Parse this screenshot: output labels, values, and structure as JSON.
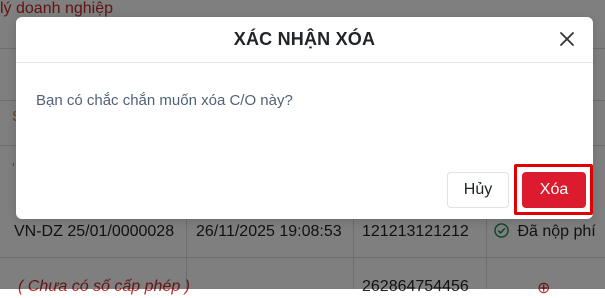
{
  "background": {
    "page_title": "lý doanh nghiệp",
    "row1": {
      "code": "VN-DZ 25/01/0000028",
      "datetime": "26/11/2025 19:08:53",
      "number": "121213121212",
      "status": "Đã nộp phí"
    },
    "row2": {
      "code": "( Chưa có số cấp phép )",
      "number": "262864754456"
    }
  },
  "dialog": {
    "title": "XÁC NHẬN XÓA",
    "message": "Bạn có chắc chắn muốn xóa C/O này?",
    "cancel_label": "Hủy",
    "delete_label": "Xóa"
  },
  "colors": {
    "delete_button": "#dc1c2e",
    "highlight_outline": "#e00000",
    "overlay": "rgba(0,0,0,0.5)"
  },
  "icons": {
    "close": "close-icon",
    "status_ok": "check-circle-icon"
  }
}
